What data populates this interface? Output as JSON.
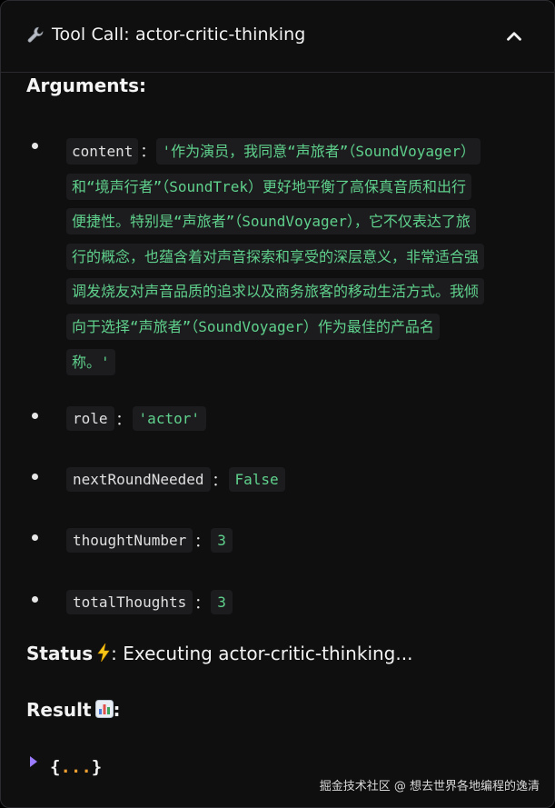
{
  "header": {
    "title": "Tool Call: actor-critic-thinking",
    "icon": "wrench-icon",
    "collapse_icon": "chevron-up-icon"
  },
  "arguments": {
    "heading": "Arguments:",
    "items": [
      {
        "key": "content",
        "value_lines": [
          "'作为演员，我同意“声旅者”（SoundVoyager）",
          "和“境声行者”（SoundTrek）更好地平衡了高保真音质和出行",
          "便捷性。特别是“声旅者”（SoundVoyager），它不仅表达了旅",
          "行的概念，也蕴含着对声音探索和享受的深层意义，非常适合强",
          "调发烧友对声音品质的追求以及商务旅客的移动生活方式。我倾",
          "向于选择“声旅者”（SoundVoyager）作为最佳的产品名",
          "称。'"
        ]
      },
      {
        "key": "role",
        "value": "'actor'"
      },
      {
        "key": "nextRoundNeeded",
        "value": "False"
      },
      {
        "key": "thoughtNumber",
        "value": "3"
      },
      {
        "key": "totalThoughts",
        "value": "3"
      }
    ],
    "separator": "："
  },
  "status": {
    "label": "Status",
    "icon": "lightning-icon",
    "text": ": Executing actor-critic-thinking..."
  },
  "result": {
    "label": "Result",
    "icon": "bar-chart-icon",
    "suffix": ":",
    "collapsed_open": "{",
    "collapsed_dots": "...",
    "collapsed_close": "}"
  },
  "watermark": "掘金技术社区 @ 想去世界各地编程的逸清",
  "colors": {
    "background": "#0f0f10",
    "code_bg": "#1c1c1f",
    "value_green": "#5fd18c",
    "dots_orange": "#f0a030",
    "toggle_purple": "#9b7bff"
  }
}
